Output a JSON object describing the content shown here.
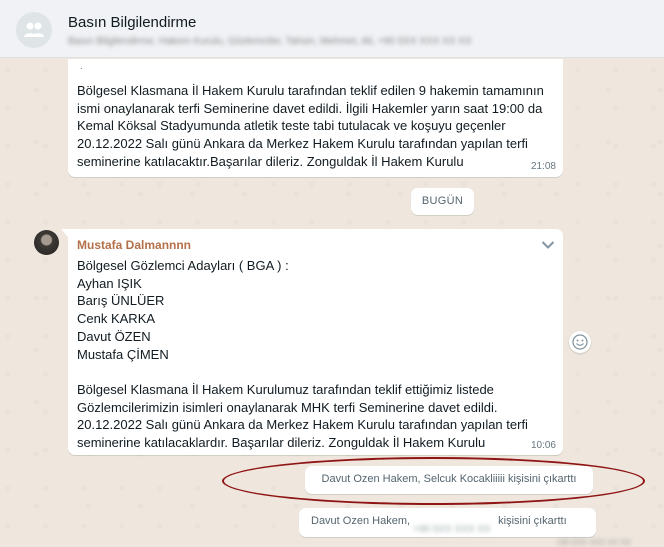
{
  "header": {
    "title": "Basın Bilgilendirme",
    "members": "Basın Bilgilendirme, Hakem Kurulu, Gözlemciler, Tahsin, Mehmet, Ali, +90 5XX XXX XX XX"
  },
  "messages": [
    {
      "text": "Bölgesel Klasmana İl Hakem Kurulu tarafından teklif edilen 9 hakemin tamamının\nismi onaylanarak terfi Seminerine davet edildi. İlgili Hakemler yarın saat 19:00 da\nKemal Köksal Stadyumunda atletik teste tabi tutulacak ve koşuyu geçenler\n20.12.2022 Salı günü  Ankara da Merkez Hakem Kurulu tarafından yapılan terfi\nseminerine katılacaktır.Başarılar dileriz. Zonguldak İl Hakem Kurulu",
      "time": "21:08",
      "top_fragment": "."
    },
    {
      "sender": "Mustafa Dalmannnn",
      "text": "Bölgesel Gözlemci Adayları ( BGA ) :\nAyhan IŞIK\nBarış ÜNLÜER\nCenk KARKA\nDavut ÖZEN\nMustafa ÇİMEN\n\nBölgesel Klasmana İl Hakem Kurulumuz tarafından teklif ettiğimiz  listede\nGözlemcilerimizin isimleri onaylanarak MHK terfi Seminerine davet edildi.\n20.12.2022 Salı günü  Ankara da Merkez Hakem Kurulu tarafından yapılan terfi\nseminerine katılacaklardır. Başarılar dileriz. Zonguldak İl Hakem Kurulu",
      "time": "10:06"
    }
  ],
  "date_chip": "BUGÜN",
  "system_messages": [
    {
      "text": "Davut Ozen Hakem, Selcuk Kocakliiiii kişisini çıkarttı"
    },
    {
      "before": "Davut Ozen Hakem,",
      "redacted": "+90 5XX XXX XX",
      "after": "kişisini çıkarttı"
    }
  ],
  "footer_blur": "+90 5XX XXX XX XX",
  "colors": {
    "chat_bg": "#efe7de",
    "sender_name": "#b4704a",
    "annotation": "#8f1515"
  }
}
